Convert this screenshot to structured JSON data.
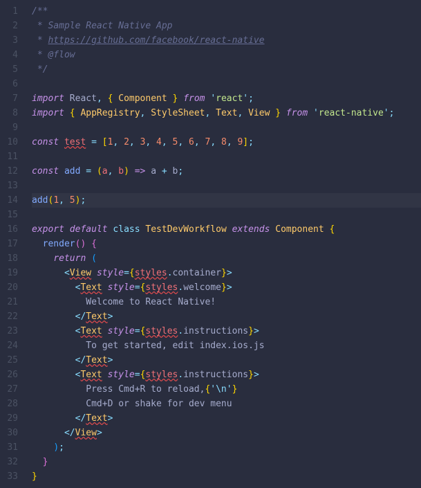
{
  "gutter": [
    "1",
    "2",
    "3",
    "4",
    "5",
    "6",
    "7",
    "8",
    "9",
    "10",
    "11",
    "12",
    "13",
    "14",
    "15",
    "16",
    "17",
    "18",
    "19",
    "20",
    "21",
    "22",
    "23",
    "24",
    "25",
    "26",
    "27",
    "28",
    "29",
    "30",
    "31",
    "32",
    "33"
  ],
  "highlighted_line": 14,
  "lines": [
    [
      [
        "c-comment",
        "/**"
      ]
    ],
    [
      [
        "c-comment",
        " * Sample React Native App"
      ]
    ],
    [
      [
        "c-comment",
        " * "
      ],
      [
        "c-link",
        "https://github.com/facebook/react-native"
      ]
    ],
    [
      [
        "c-comment",
        " * @flow"
      ]
    ],
    [
      [
        "c-comment",
        " */"
      ]
    ],
    [
      [
        "c-text",
        ""
      ]
    ],
    [
      [
        "c-kw",
        "import"
      ],
      [
        "c-text",
        " "
      ],
      [
        "c-def",
        "React"
      ],
      [
        "c-punct",
        ","
      ],
      [
        "c-text",
        " "
      ],
      [
        "c-brace",
        "{"
      ],
      [
        "c-text",
        " "
      ],
      [
        "c-type",
        "Component"
      ],
      [
        "c-text",
        " "
      ],
      [
        "c-brace",
        "}"
      ],
      [
        "c-text",
        " "
      ],
      [
        "c-kw",
        "from"
      ],
      [
        "c-text",
        " "
      ],
      [
        "c-punct",
        "'"
      ],
      [
        "c-str",
        "react"
      ],
      [
        "c-punct",
        "'"
      ],
      [
        "c-punct",
        ";"
      ]
    ],
    [
      [
        "c-kw",
        "import"
      ],
      [
        "c-text",
        " "
      ],
      [
        "c-brace",
        "{"
      ],
      [
        "c-text",
        " "
      ],
      [
        "c-type",
        "AppRegistry"
      ],
      [
        "c-punct",
        ","
      ],
      [
        "c-text",
        " "
      ],
      [
        "c-type",
        "StyleSheet"
      ],
      [
        "c-punct",
        ","
      ],
      [
        "c-text",
        " "
      ],
      [
        "c-type",
        "Text"
      ],
      [
        "c-punct",
        ","
      ],
      [
        "c-text",
        " "
      ],
      [
        "c-type",
        "View"
      ],
      [
        "c-text",
        " "
      ],
      [
        "c-brace",
        "}"
      ],
      [
        "c-text",
        " "
      ],
      [
        "c-kw",
        "from"
      ],
      [
        "c-text",
        " "
      ],
      [
        "c-punct",
        "'"
      ],
      [
        "c-str",
        "react-native"
      ],
      [
        "c-punct",
        "'"
      ],
      [
        "c-punct",
        ";"
      ]
    ],
    [
      [
        "c-text",
        ""
      ]
    ],
    [
      [
        "c-kw",
        "const"
      ],
      [
        "c-text",
        " "
      ],
      [
        "c-varU",
        "test"
      ],
      [
        "c-text",
        " "
      ],
      [
        "c-op",
        "="
      ],
      [
        "c-text",
        " "
      ],
      [
        "c-brace",
        "["
      ],
      [
        "c-num",
        "1"
      ],
      [
        "c-punct",
        ","
      ],
      [
        "c-text",
        " "
      ],
      [
        "c-num",
        "2"
      ],
      [
        "c-punct",
        ","
      ],
      [
        "c-text",
        " "
      ],
      [
        "c-num",
        "3"
      ],
      [
        "c-punct",
        ","
      ],
      [
        "c-text",
        " "
      ],
      [
        "c-num",
        "4"
      ],
      [
        "c-punct",
        ","
      ],
      [
        "c-text",
        " "
      ],
      [
        "c-num",
        "5"
      ],
      [
        "c-punct",
        ","
      ],
      [
        "c-text",
        " "
      ],
      [
        "c-num",
        "6"
      ],
      [
        "c-punct",
        ","
      ],
      [
        "c-text",
        " "
      ],
      [
        "c-num",
        "7"
      ],
      [
        "c-punct",
        ","
      ],
      [
        "c-text",
        " "
      ],
      [
        "c-num",
        "8"
      ],
      [
        "c-punct",
        ","
      ],
      [
        "c-text",
        " "
      ],
      [
        "c-num",
        "9"
      ],
      [
        "c-brace",
        "]"
      ],
      [
        "c-punct",
        ";"
      ]
    ],
    [
      [
        "c-text",
        ""
      ]
    ],
    [
      [
        "c-kw",
        "const"
      ],
      [
        "c-text",
        " "
      ],
      [
        "c-fn",
        "add"
      ],
      [
        "c-text",
        " "
      ],
      [
        "c-op",
        "="
      ],
      [
        "c-text",
        " "
      ],
      [
        "c-brace",
        "("
      ],
      [
        "c-var",
        "a"
      ],
      [
        "c-punct",
        ","
      ],
      [
        "c-text",
        " "
      ],
      [
        "c-var",
        "b"
      ],
      [
        "c-brace",
        ")"
      ],
      [
        "c-text",
        " "
      ],
      [
        "c-kw",
        "=>"
      ],
      [
        "c-text",
        " "
      ],
      [
        "c-def",
        "a"
      ],
      [
        "c-text",
        " "
      ],
      [
        "c-op",
        "+"
      ],
      [
        "c-text",
        " "
      ],
      [
        "c-def",
        "b"
      ],
      [
        "c-punct",
        ";"
      ]
    ],
    [
      [
        "c-text",
        ""
      ]
    ],
    [
      [
        "c-fn",
        "add"
      ],
      [
        "c-brace",
        "("
      ],
      [
        "c-num",
        "1"
      ],
      [
        "c-punct",
        ","
      ],
      [
        "c-text",
        " "
      ],
      [
        "c-num",
        "5"
      ],
      [
        "c-brace",
        ")"
      ],
      [
        "c-punct",
        ";"
      ]
    ],
    [
      [
        "c-text",
        ""
      ]
    ],
    [
      [
        "c-kw",
        "export"
      ],
      [
        "c-text",
        " "
      ],
      [
        "c-kw",
        "default"
      ],
      [
        "c-text",
        " "
      ],
      [
        "c-kw2",
        "class"
      ],
      [
        "c-text",
        " "
      ],
      [
        "c-type",
        "TestDevWorkflow"
      ],
      [
        "c-text",
        " "
      ],
      [
        "c-kw",
        "extends"
      ],
      [
        "c-text",
        " "
      ],
      [
        "c-type",
        "Component"
      ],
      [
        "c-text",
        " "
      ],
      [
        "c-brace",
        "{"
      ]
    ],
    [
      [
        "c-text",
        "  "
      ],
      [
        "c-fn",
        "render"
      ],
      [
        "c-brace2",
        "("
      ],
      [
        "c-brace2",
        ")"
      ],
      [
        "c-text",
        " "
      ],
      [
        "c-brace2",
        "{"
      ]
    ],
    [
      [
        "c-text",
        "    "
      ],
      [
        "c-kw",
        "return"
      ],
      [
        "c-text",
        " "
      ],
      [
        "c-brace3",
        "("
      ]
    ],
    [
      [
        "c-text",
        "      "
      ],
      [
        "c-punct",
        "<"
      ],
      [
        "c-typeU",
        "View"
      ],
      [
        "c-text",
        " "
      ],
      [
        "c-attr",
        "style"
      ],
      [
        "c-op",
        "="
      ],
      [
        "c-brace",
        "{"
      ],
      [
        "c-varU",
        "styles"
      ],
      [
        "c-punct",
        "."
      ],
      [
        "c-def",
        "container"
      ],
      [
        "c-brace",
        "}"
      ],
      [
        "c-punct",
        ">"
      ]
    ],
    [
      [
        "c-text",
        "        "
      ],
      [
        "c-punct",
        "<"
      ],
      [
        "c-typeU",
        "Text"
      ],
      [
        "c-text",
        " "
      ],
      [
        "c-attr",
        "style"
      ],
      [
        "c-op",
        "="
      ],
      [
        "c-brace",
        "{"
      ],
      [
        "c-varU",
        "styles"
      ],
      [
        "c-punct",
        "."
      ],
      [
        "c-def",
        "welcome"
      ],
      [
        "c-brace",
        "}"
      ],
      [
        "c-punct",
        ">"
      ]
    ],
    [
      [
        "c-text",
        "          Welcome to React Native!"
      ]
    ],
    [
      [
        "c-text",
        "        "
      ],
      [
        "c-punct",
        "</"
      ],
      [
        "c-typeU",
        "Text"
      ],
      [
        "c-punct",
        ">"
      ]
    ],
    [
      [
        "c-text",
        "        "
      ],
      [
        "c-punct",
        "<"
      ],
      [
        "c-typeU",
        "Text"
      ],
      [
        "c-text",
        " "
      ],
      [
        "c-attr",
        "style"
      ],
      [
        "c-op",
        "="
      ],
      [
        "c-brace",
        "{"
      ],
      [
        "c-varU",
        "styles"
      ],
      [
        "c-punct",
        "."
      ],
      [
        "c-def",
        "instructions"
      ],
      [
        "c-brace",
        "}"
      ],
      [
        "c-punct",
        ">"
      ]
    ],
    [
      [
        "c-text",
        "          To get started, edit index.ios.js"
      ]
    ],
    [
      [
        "c-text",
        "        "
      ],
      [
        "c-punct",
        "</"
      ],
      [
        "c-typeU",
        "Text"
      ],
      [
        "c-punct",
        ">"
      ]
    ],
    [
      [
        "c-text",
        "        "
      ],
      [
        "c-punct",
        "<"
      ],
      [
        "c-typeU",
        "Text"
      ],
      [
        "c-text",
        " "
      ],
      [
        "c-attr",
        "style"
      ],
      [
        "c-op",
        "="
      ],
      [
        "c-brace",
        "{"
      ],
      [
        "c-varU",
        "styles"
      ],
      [
        "c-punct",
        "."
      ],
      [
        "c-def",
        "instructions"
      ],
      [
        "c-brace",
        "}"
      ],
      [
        "c-punct",
        ">"
      ]
    ],
    [
      [
        "c-text",
        "          Press Cmd+R to reload,"
      ],
      [
        "c-brace",
        "{"
      ],
      [
        "c-punct",
        "'"
      ],
      [
        "c-esc",
        "\\n"
      ],
      [
        "c-punct",
        "'"
      ],
      [
        "c-brace",
        "}"
      ]
    ],
    [
      [
        "c-text",
        "          Cmd+D or shake for dev menu"
      ]
    ],
    [
      [
        "c-text",
        "        "
      ],
      [
        "c-punct",
        "</"
      ],
      [
        "c-typeU",
        "Text"
      ],
      [
        "c-punct",
        ">"
      ]
    ],
    [
      [
        "c-text",
        "      "
      ],
      [
        "c-punct",
        "</"
      ],
      [
        "c-typeU",
        "View"
      ],
      [
        "c-punct",
        ">"
      ]
    ],
    [
      [
        "c-text",
        "    "
      ],
      [
        "c-brace3",
        ")"
      ],
      [
        "c-punct",
        ";"
      ]
    ],
    [
      [
        "c-text",
        "  "
      ],
      [
        "c-brace2",
        "}"
      ]
    ],
    [
      [
        "c-brace",
        "}"
      ]
    ]
  ]
}
